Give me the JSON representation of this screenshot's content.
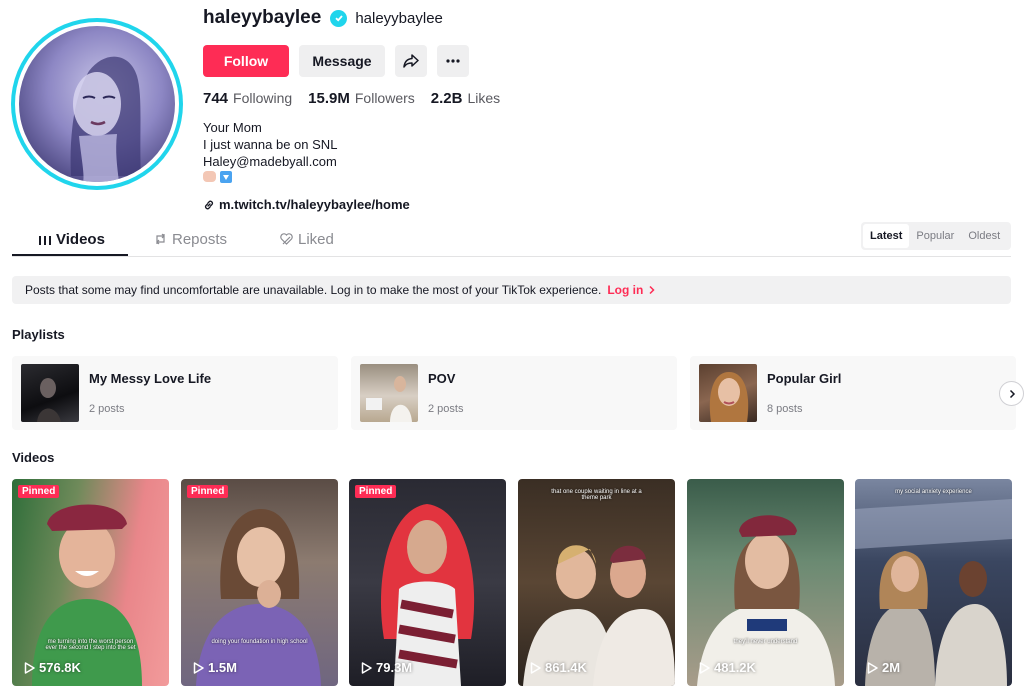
{
  "profile": {
    "username": "haleyybaylee",
    "handle": "haleyybaylee",
    "follow_label": "Follow",
    "message_label": "Message",
    "following_count": "744",
    "following_label": "Following",
    "followers_count": "15.9M",
    "followers_label": "Followers",
    "likes_count": "2.2B",
    "likes_label": "Likes",
    "bio_line1": "Your Mom",
    "bio_line2": "I just wanna be on SNL",
    "bio_line3": "Haley@madebyall.com",
    "link": "m.twitch.tv/haleyybaylee/home"
  },
  "tabs": [
    {
      "label": "Videos",
      "icon": "grid-icon"
    },
    {
      "label": "Reposts",
      "icon": "repost-icon"
    },
    {
      "label": "Liked",
      "icon": "heart-icon"
    }
  ],
  "sort": {
    "latest": "Latest",
    "popular": "Popular",
    "oldest": "Oldest"
  },
  "notice": {
    "text": "Posts that some may find uncomfortable are unavailable. Log in to make the most of your TikTok experience.",
    "login_label": "Log in"
  },
  "playlists_title": "Playlists",
  "playlists": [
    {
      "title": "My Messy Love Life",
      "count": "2 posts"
    },
    {
      "title": "POV",
      "count": "2 posts"
    },
    {
      "title": "Popular Girl",
      "count": "8 posts"
    }
  ],
  "videos_title": "Videos",
  "videos": [
    {
      "pinned": "Pinned",
      "plays": "576.8K",
      "caption": "me turning into the worst person ever the second I step into the set"
    },
    {
      "pinned": "Pinned",
      "plays": "1.5M",
      "caption": "doing your foundation in high school"
    },
    {
      "pinned": "Pinned",
      "plays": "79.3M",
      "caption": ""
    },
    {
      "pinned": "",
      "plays": "861.4K",
      "caption_top": "that one couple waiting in line at a theme park"
    },
    {
      "pinned": "",
      "plays": "481.2K",
      "caption": "they'll never understand"
    },
    {
      "pinned": "",
      "plays": "2M",
      "caption_top": "my social anxiety experience"
    }
  ],
  "colors": {
    "accent": "#fe2c55",
    "verified": "#20d5ec",
    "avatar_ring": "#20d5ec"
  }
}
